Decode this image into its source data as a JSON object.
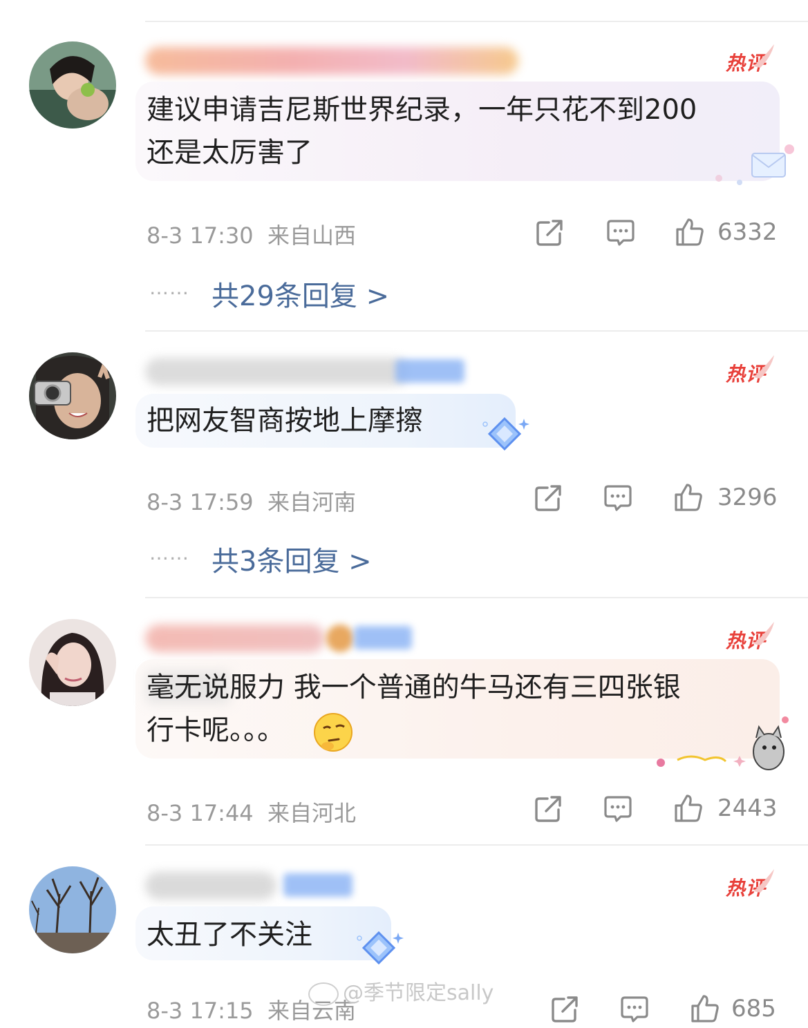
{
  "comments": [
    {
      "hot_label": "热评",
      "content": "建议申请吉尼斯世界纪录，一年只花不到200\n还是太厉害了",
      "time": "8-3 17:30",
      "location": "来自山西",
      "likes": "6332",
      "replies": "共29条回复 >"
    },
    {
      "hot_label": "热评",
      "content": "把网友智商按地上摩擦",
      "time": "8-3 17:59",
      "location": "来自河南",
      "likes": "3296",
      "replies": "共3条回复 >"
    },
    {
      "hot_label": "热评",
      "content": "毫无说服力 我一个普通的牛马还有三四张银\n行卡呢。。。",
      "time": "8-3 17:44",
      "location": "来自河北",
      "likes": "2443"
    },
    {
      "hot_label": "热评",
      "content": "太丑了不关注",
      "time": "8-3 17:15",
      "location": "来自云南",
      "likes": "685"
    }
  ],
  "reply_dots": "……",
  "watermark": "@季节限定sally",
  "icons": {
    "share": "share-icon",
    "comment": "comment-icon",
    "like": "thumbs-up-icon",
    "emoji": "thinking-emoji-icon"
  },
  "colors": {
    "hot_red": "#e8403a",
    "reply_blue": "#4a6b9a",
    "meta_gray": "#9a9a9a"
  }
}
